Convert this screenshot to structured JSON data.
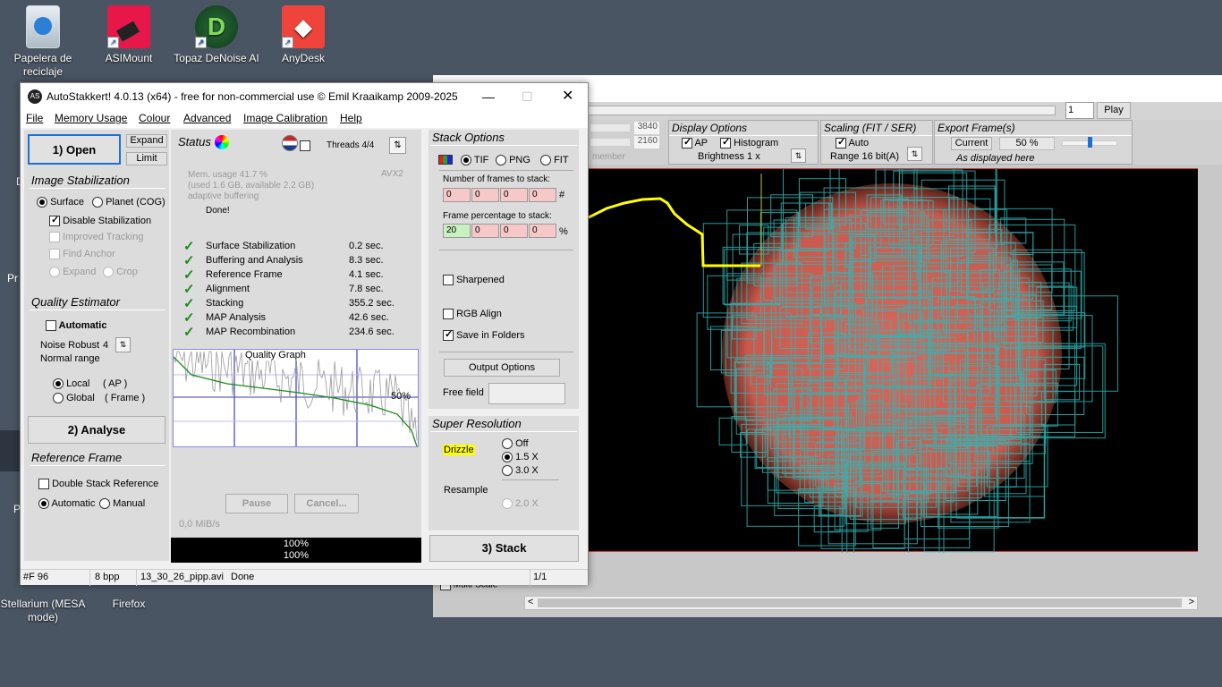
{
  "desktop": {
    "icons": [
      {
        "label": "Papelera de reciclaje",
        "icon": "recycle-bin-icon"
      },
      {
        "label": "ASIMount",
        "icon": "asimount-icon"
      },
      {
        "label": "Topaz DeNoise AI",
        "icon": "topaz-denoise-icon"
      },
      {
        "label": "AnyDesk",
        "icon": "anydesk-icon"
      },
      {
        "label": "Stellarium (MESA mode)",
        "icon": "stellarium-icon"
      },
      {
        "label": "Firefox",
        "icon": "firefox-icon"
      }
    ],
    "partial_labels": [
      "D",
      "Pr",
      "P"
    ]
  },
  "viewer_window": {
    "frame_input": "1",
    "play_label": "Play",
    "size_w": "3840",
    "size_h": "2160",
    "member_text": "member",
    "display_options": {
      "title": "Display Options",
      "ap_label": "AP",
      "histogram_label": "Histogram",
      "brightness": "Brightness  1 x"
    },
    "scaling": {
      "title": "Scaling (FIT / SER)",
      "auto_label": "Auto",
      "range": "Range 16 bit(A)"
    },
    "export": {
      "title": "Export Frame(s)",
      "current_label": "Current",
      "percent": "50 %",
      "note": "As displayed here"
    },
    "multiscale_label": "Multi-Scale"
  },
  "as_window": {
    "title": "AutoStakkert! 4.0.13 (x64) - free for non-commercial use © Emil Kraaikamp 2009-2025",
    "menu": [
      "File",
      "Memory Usage",
      "Colour",
      "Advanced",
      "Image Calibration",
      "Help"
    ],
    "left": {
      "open_label": "1) Open",
      "expand_label": "Expand",
      "limit_label": "Limit",
      "stab_title": "Image Stabilization",
      "surface_label": "Surface",
      "planet_label": "Planet (COG)",
      "disable_stab_label": "Disable Stabilization",
      "improved_tracking_label": "Improved Tracking",
      "find_anchor_label": "Find Anchor",
      "expand2_label": "Expand",
      "crop_label": "Crop",
      "quality_title": "Quality Estimator",
      "automatic_label": "Automatic",
      "noise_robust_label": "Noise Robust",
      "noise_robust_value": "4",
      "normal_range_label": "Normal range",
      "local_label": "Local",
      "local_ap": "( AP )",
      "global_label": "Global",
      "global_frame": "( Frame )",
      "analyse_label": "2) Analyse",
      "ref_title": "Reference Frame",
      "double_stack_label": "Double Stack Reference",
      "automatic2_label": "Automatic",
      "manual_label": "Manual"
    },
    "status": {
      "title": "Status",
      "threads": "Threads 4/4",
      "mem_usage": "Mem. usage 41.7 %",
      "mem_detail": "(used 1.6 GB, available 2.2 GB)",
      "buffering": "adaptive buffering",
      "avx": "AVX2",
      "done": "Done!",
      "steps": [
        {
          "name": "Surface Stabilization",
          "time": "0.2 sec."
        },
        {
          "name": "Buffering and Analysis",
          "time": "8.3 sec."
        },
        {
          "name": "Reference Frame",
          "time": "4.1 sec."
        },
        {
          "name": "Alignment",
          "time": "7.8 sec."
        },
        {
          "name": "Stacking",
          "time": "355.2 sec."
        },
        {
          "name": "MAP Analysis",
          "time": "42.6 sec."
        },
        {
          "name": "MAP Recombination",
          "time": "234.6 sec."
        }
      ],
      "graph_title": "Quality Graph",
      "graph_pct": "50%",
      "pause_label": "Pause",
      "cancel_label": "Cancel...",
      "throughput": "0,0 MiB/s",
      "progress1": "100%",
      "progress2": "100%"
    },
    "stack": {
      "title": "Stack Options",
      "tif_label": "TIF",
      "png_label": "PNG",
      "fit_label": "FIT",
      "frames_label": "Number of frames to stack:",
      "frames": [
        "0",
        "0",
        "0",
        "0"
      ],
      "frames_unit": "#",
      "pct_label": "Frame percentage to stack:",
      "pct": [
        "20",
        "0",
        "0",
        "0"
      ],
      "pct_unit": "%",
      "sharpened_label": "Sharpened",
      "rgb_align_label": "RGB Align",
      "save_folders_label": "Save in Folders",
      "output_options_label": "Output Options",
      "free_field_label": "Free field",
      "sr_title": "Super Resolution",
      "drizzle_label": "Drizzle",
      "off_label": "Off",
      "x15_label": "1.5 X",
      "x30_label": "3.0 X",
      "resample_label": "Resample",
      "x20_label": "2.0 X",
      "stack_label": "3) Stack"
    },
    "statusbar": {
      "frames": "#F 96",
      "bpp": "8 bpp",
      "file": "13_30_26_pipp.avi",
      "state": "Done",
      "page": "1/1"
    }
  },
  "colors": {
    "desktop": "#4a5563",
    "sun": "#d9675a",
    "ap_boxes": "#2fb6b6",
    "highlight": "#ffff00"
  }
}
